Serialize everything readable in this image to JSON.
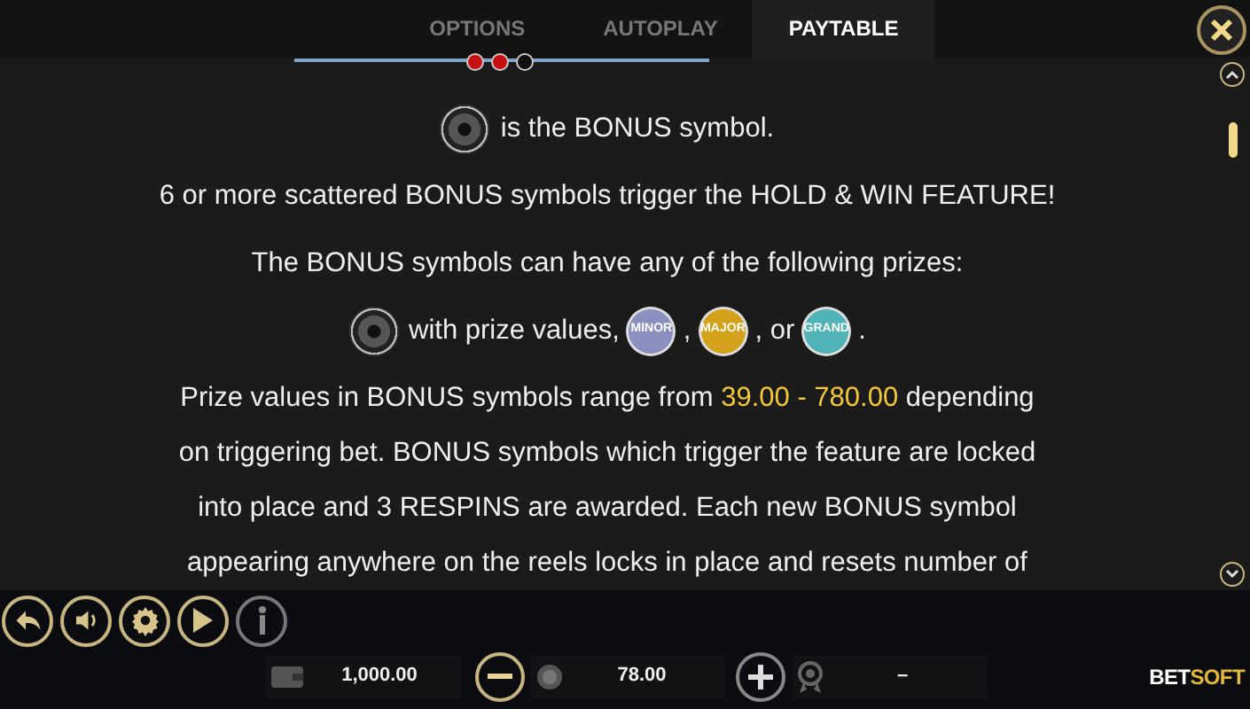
{
  "tabs": [
    {
      "label": "OPTIONS",
      "selected": false
    },
    {
      "label": "AUTOPLAY",
      "selected": false
    },
    {
      "label": "PAYTABLE",
      "selected": true
    }
  ],
  "page_dots": [
    {
      "filled": true
    },
    {
      "filled": true
    },
    {
      "filled": false
    }
  ],
  "content": [
    {
      "kind": "symbol_line",
      "text": "is the BONUS symbol."
    },
    {
      "kind": "text",
      "text": "6 or more scattered BONUS symbols trigger the HOLD & WIN FEATURE!"
    },
    {
      "kind": "text",
      "text": "The BONUS symbols can have any of the following prizes:"
    },
    {
      "kind": "prizes",
      "text": "with prize values,",
      "badges": [
        {
          "label": "MINOR",
          "color": "#8a8fc0"
        },
        {
          "label": "MAJOR",
          "color": "#d4a21a"
        },
        {
          "label": "GRAND",
          "color": "#4fb3b8"
        }
      ],
      "separators": [
        ",",
        ", or",
        "."
      ]
    },
    {
      "kind": "paragraph",
      "lines": [
        [
          {
            "text": "Prize values in BONUS symbols range from ",
            "highlight": false
          },
          {
            "text": "39.00 - 780.00",
            "highlight": true
          },
          {
            "text": " depending",
            "highlight": false
          }
        ],
        [
          {
            "text": "on triggering bet. BONUS symbols which trigger the feature are locked",
            "highlight": false
          }
        ],
        [
          {
            "text": "into place and 3 RESPINS are awarded. Each new BONUS symbol",
            "highlight": false
          }
        ],
        [
          {
            "text": "appearing anywhere on the reels locks in place and resets number of",
            "highlight": false
          }
        ]
      ]
    }
  ],
  "toolbar": [
    {
      "kind": "back",
      "disabled": false
    },
    {
      "kind": "sound",
      "disabled": false
    },
    {
      "kind": "settings",
      "disabled": false
    },
    {
      "kind": "autoplay",
      "disabled": false
    },
    {
      "kind": "info",
      "disabled": true
    }
  ],
  "balance": "1,000.00",
  "bet": "78.00",
  "win": "–",
  "logo": {
    "part_1": "BET",
    "part_2": "SOFT"
  }
}
